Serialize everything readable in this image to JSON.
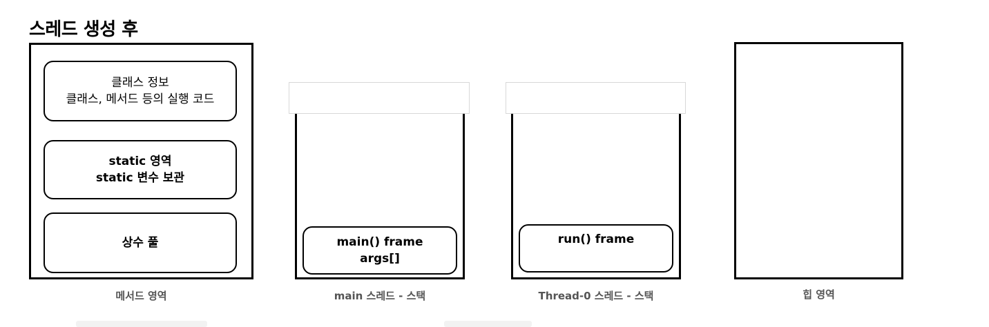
{
  "title": "스레드 생성 후",
  "method_area": {
    "caption": "메서드 영역",
    "class_info": {
      "line1": "클래스 정보",
      "line2": "클래스, 메서드 등의 실행 코드"
    },
    "static_area": {
      "line1": "static 영역",
      "line2": "static 변수 보관"
    },
    "constant_pool": {
      "line1": "상수 풀"
    }
  },
  "main_stack": {
    "caption": "main 스레드 - 스택",
    "frame": {
      "line1": "main() frame",
      "line2": "args[]"
    }
  },
  "thread0_stack": {
    "caption": "Thread-0 스레드 - 스택",
    "frame": {
      "line1": "run() frame"
    }
  },
  "heap": {
    "caption": "힙 영역"
  }
}
